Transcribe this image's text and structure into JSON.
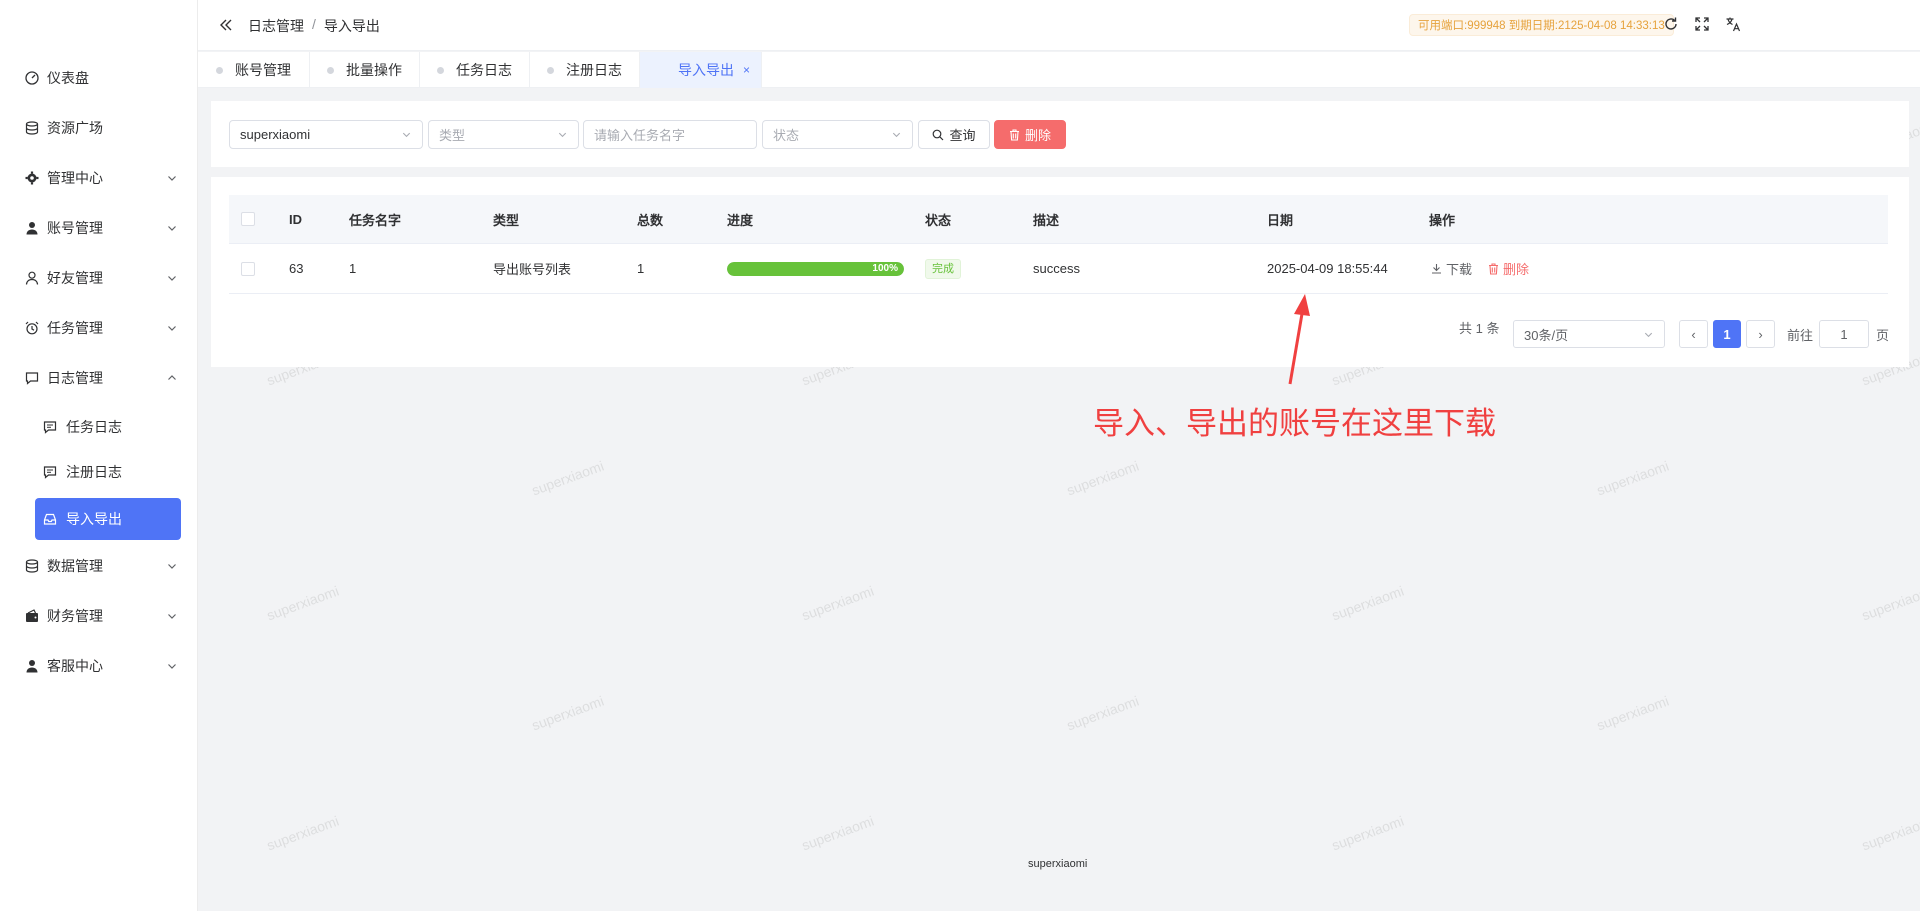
{
  "sidebar": {
    "items": [
      {
        "label": "仪表盘",
        "icon": "dashboard-icon"
      },
      {
        "label": "资源广场",
        "icon": "database-icon"
      },
      {
        "label": "管理中心",
        "icon": "gear-icon"
      },
      {
        "label": "账号管理",
        "icon": "user-icon"
      },
      {
        "label": "好友管理",
        "icon": "user-outline-icon"
      },
      {
        "label": "任务管理",
        "icon": "alarm-clock-icon"
      },
      {
        "label": "日志管理",
        "icon": "chat-bubble-icon"
      },
      {
        "label": "数据管理",
        "icon": "database-icon"
      },
      {
        "label": "财务管理",
        "icon": "wallet-icon"
      },
      {
        "label": "客服中心",
        "icon": "user-icon"
      }
    ],
    "subitems": [
      {
        "label": "任务日志"
      },
      {
        "label": "注册日志"
      },
      {
        "label": "导入导出"
      }
    ]
  },
  "header": {
    "breadcrumb": [
      "日志管理",
      "导入导出"
    ],
    "breadcrumb_sep": "/",
    "expire_badge": "可用端口:999948 到期日期:2125-04-08 14:33:13"
  },
  "tabs": [
    {
      "label": "账号管理"
    },
    {
      "label": "批量操作"
    },
    {
      "label": "任务日志"
    },
    {
      "label": "注册日志"
    },
    {
      "label": "导入导出",
      "active": true
    }
  ],
  "tab_close": "×",
  "filters": {
    "user_value": "superxiaomi",
    "type_placeholder": "类型",
    "name_placeholder": "请输入任务名字",
    "status_placeholder": "状态",
    "query_label": "查询",
    "delete_label": "删除"
  },
  "table": {
    "columns": [
      "ID",
      "任务名字",
      "类型",
      "总数",
      "进度",
      "状态",
      "描述",
      "日期",
      "操作"
    ],
    "rows": [
      {
        "id": "63",
        "name": "1",
        "type": "导出账号列表",
        "total": "1",
        "progress": 100,
        "progress_text": "100%",
        "status": "完成",
        "desc": "success",
        "date": "2025-04-09 18:55:44",
        "op_download": "下载",
        "op_delete": "删除"
      }
    ]
  },
  "pagination": {
    "total_text": "共 1 条",
    "page_size": "30条/页",
    "prev": "‹",
    "current": "1",
    "next": "›",
    "goto_label": "前往",
    "goto_value": "1",
    "page_suffix": "页"
  },
  "annotation": {
    "text": "导入、导出的账号在这里下载",
    "color": "#f04040"
  },
  "footer": {
    "text": "superxiaomi"
  },
  "watermark": "superxiaomi",
  "colors": {
    "primary": "#4f74f6",
    "danger": "#f56c6c",
    "success": "#67c23a",
    "warning": "#e6a23c"
  }
}
